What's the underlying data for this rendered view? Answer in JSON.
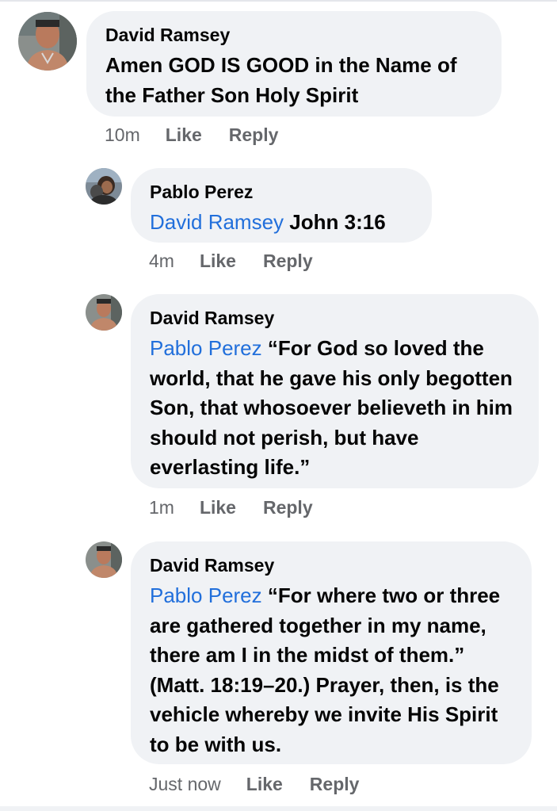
{
  "comments": [
    {
      "author": "David Ramsey",
      "mention": "",
      "text": "Amen GOD IS GOOD in the Name of the Father Son Holy Spirit",
      "time": "10m",
      "like_label": "Like",
      "reply_label": "Reply"
    },
    {
      "author": "Pablo Perez",
      "mention": "David Ramsey",
      "text": " John 3:16",
      "time": "4m",
      "like_label": "Like",
      "reply_label": "Reply"
    },
    {
      "author": "David Ramsey",
      "mention": "Pablo Perez",
      "text": " “For God so loved the world, that he gave his only begotten Son, that whosoever believeth in him should not perish, but have everlasting life.”",
      "time": "1m",
      "like_label": "Like",
      "reply_label": "Reply"
    },
    {
      "author": "David Ramsey",
      "mention": "Pablo Perez",
      "text": " “For where two or three are gathered together in my name, there am I in the midst of them.” (Matt. 18:19–20.) Prayer, then, is the vehicle whereby we invite His Spirit to be with us.",
      "time": "Just now",
      "like_label": "Like",
      "reply_label": "Reply"
    }
  ],
  "colors": {
    "bubble": "#f0f2f5",
    "mention": "#216fdb",
    "meta": "#65676b",
    "text": "#050505"
  },
  "icons": {
    "avatar_david": "avatar-david-icon",
    "avatar_pablo": "avatar-pablo-icon"
  }
}
